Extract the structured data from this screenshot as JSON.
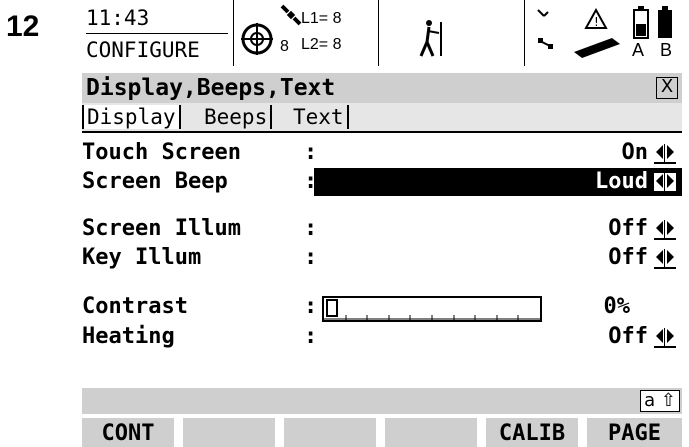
{
  "step_number": "12",
  "status_bar": {
    "time": "11:43",
    "mode": "CONFIGURE",
    "satellite_count": "8",
    "l1_label": "L1= 8",
    "l2_label": "L2= 8",
    "storage_label": "A B"
  },
  "window": {
    "title": "Display,Beeps,Text",
    "close_glyph": "X"
  },
  "tabs": [
    {
      "label": "Display",
      "active": true
    },
    {
      "label": "Beeps",
      "active": false
    },
    {
      "label": "Text",
      "active": false
    }
  ],
  "fields": {
    "touch_screen": {
      "label": "Touch Screen",
      "colon": ":",
      "value": "On"
    },
    "screen_beep": {
      "label": "Screen Beep",
      "colon": ":",
      "value": "Loud"
    },
    "screen_illum": {
      "label": "Screen Illum",
      "colon": ":",
      "value": "Off"
    },
    "key_illum": {
      "label": "Key Illum",
      "colon": ":",
      "value": "Off"
    },
    "contrast": {
      "label": "Contrast",
      "colon": ":",
      "value": "0%",
      "level_percent": 0
    },
    "heating": {
      "label": "Heating",
      "colon": ":",
      "value": "Off"
    }
  },
  "input_mode": "a ⇧",
  "function_keys": [
    "CONT",
    "",
    "",
    "",
    "CALIB",
    "PAGE"
  ]
}
